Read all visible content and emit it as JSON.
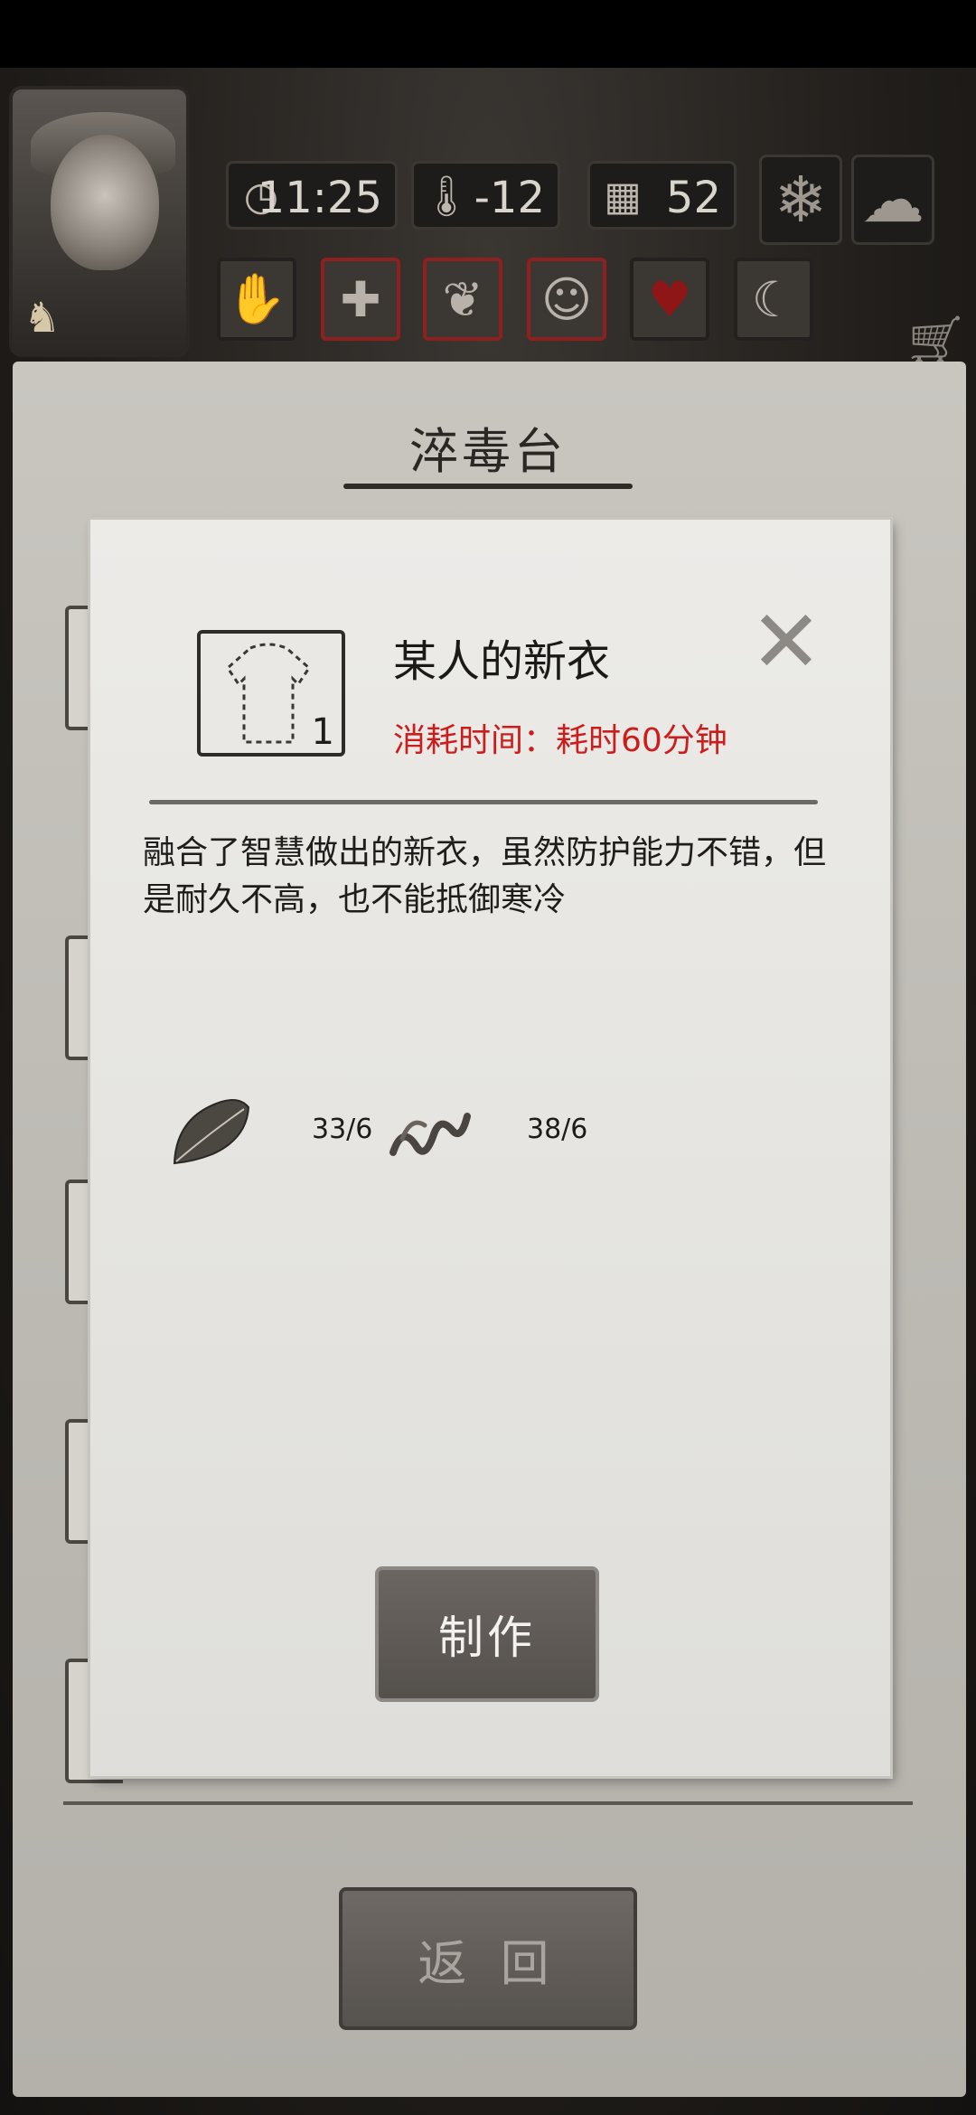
{
  "hud": {
    "time": "11:25",
    "temperature": "-12",
    "day": "52",
    "weather_icons": [
      "snowflake-icon",
      "cloud-icon"
    ],
    "status_icons": [
      "hand-icon",
      "medical-cross-icon",
      "stomach-icon",
      "head-icon",
      "heart-icon",
      "moon-icon"
    ],
    "accent_red": "#8e2020"
  },
  "workbench": {
    "title": "淬毒台",
    "back_label": "返 回"
  },
  "dialog": {
    "item_name": "某人的新衣",
    "item_count": "1",
    "time_cost": "消耗时间：耗时60分钟",
    "description": "融合了智慧做出的新衣，虽然防护能力不错，但是耐久不高，也不能抵御寒冷",
    "materials": [
      {
        "icon": "leaf-icon",
        "count": "33/6"
      },
      {
        "icon": "vine-icon",
        "count": "38/6"
      }
    ],
    "make_label": "制作",
    "time_color": "#cc1d1d"
  }
}
